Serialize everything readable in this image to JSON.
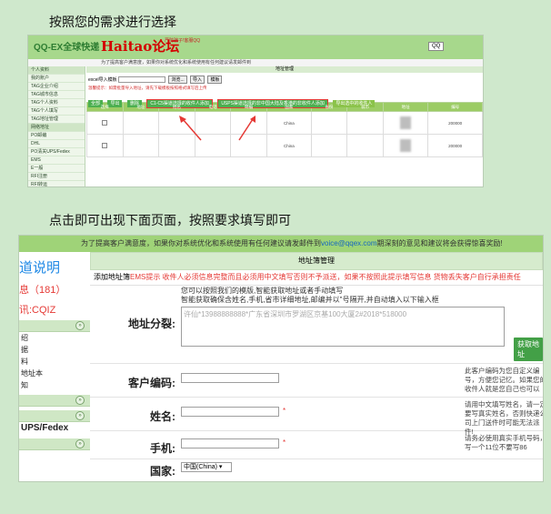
{
  "instructions": {
    "step1": "按照您的需求进行选择",
    "step2": "点击即可出现下面页面，按照要求填写即可"
  },
  "colors": {
    "background": "#cfe8cc",
    "banner_green": "#a7d88c",
    "button_green": "#43a047",
    "warning_red": "#e53935",
    "link_blue": "#1565c0"
  },
  "shot1": {
    "logo": "QQ-EX全球快递",
    "brand": "Haitao论坛",
    "promo": "严防骗子!客服QQ",
    "notice": "为了提高客户满意度，如果你对系统优化和系统使用有任何建议请发邮件到",
    "sidebar": [
      "个人资料",
      "我的账户",
      "TAG企业介绍",
      "TAG城市信息",
      "TAG个人资料",
      "TAG个人填写",
      "TAG地址管理",
      "网络地址",
      "PO邮编",
      "DHL",
      "PO清关UPS/Fedex",
      "EMS",
      "E一般",
      "RFI注册",
      "RFI转运"
    ],
    "page_title": "地址管理",
    "field_label": "excel导入模板",
    "btn_browse": "浏览...",
    "btn_import": "导入",
    "btn_download": "模板",
    "red_note": "温馨提示：如需批量导入地址，请先下载模板按照格式填写后上传",
    "tabs": {
      "tab_a": "全部",
      "tab_b": "导出",
      "tab_c": "删除",
      "boxed1": "C1-C5渠道选择的收件人添加",
      "boxed2": "USPS渠道选择的非中国大陆及香港的非收件人添加",
      "plain": "导出选中的收件人"
    },
    "headers": [
      "选择",
      "地址",
      "姓名",
      "电话",
      "邮编",
      "国家",
      "省份",
      "城市",
      "地址",
      "编号"
    ],
    "rows": [
      [
        "",
        "",
        "",
        "",
        "",
        "China",
        "",
        "",
        "",
        "200000"
      ],
      [
        "",
        "",
        "",
        "",
        "",
        "China",
        "",
        "",
        "",
        "200000"
      ]
    ]
  },
  "shot2": {
    "notice_pre": "为了提高客户满意度，如果你对系统优化和系统使用有任何建议请发邮件到",
    "notice_email": "voice@qqex.com",
    "notice_post": "期深刻的意见和建议将会获得惊喜奖励!",
    "sidebar_title": "道说明",
    "sidebar_line2": "息（181）",
    "sidebar_line3": "讯:CQIZ",
    "sidebar_items": [
      "绍",
      "据",
      "料",
      "地址本",
      "知"
    ],
    "sidebar_ups": "UPS/Fedex",
    "page_title": "地址簿管理",
    "warn_black": "添加地址簿",
    "warn_red": "EMS提示 收件人必须信息完整而且必须用中文填写否则不予派送，如果不按照此提示填写信息 货物丢失客户自行承担责任",
    "parse_label": "地址分裂:",
    "parse_desc1": "您可以按照我们的模版,智能获取地址或者手动填写",
    "parse_desc2": "智能获取确保含姓名,手机,省市详细地址,邮编并以\"号隔开,并自动填入以下输入框",
    "parse_placeholder": "许仙*13988888888*广东省深圳市罗湖区京基100大厦2#2018*518000",
    "get_address_btn": "获取地址",
    "customer_code_label": "客户编码:",
    "customer_code_help": "此客户编码为您自定义编号，方便您记忆。如果您的收件人就是您自己也可以",
    "name_label": "姓名:",
    "name_help": "请用中文填写姓名，请一定要写真实姓名，否则快递公司上门送件时可能无法派件!",
    "phone_label": "手机:",
    "phone_help": "请务必使用真实手机号码，写一个11位不要写86",
    "country_label": "国家:",
    "country_value": "中国(China)",
    "required_star": "*"
  }
}
